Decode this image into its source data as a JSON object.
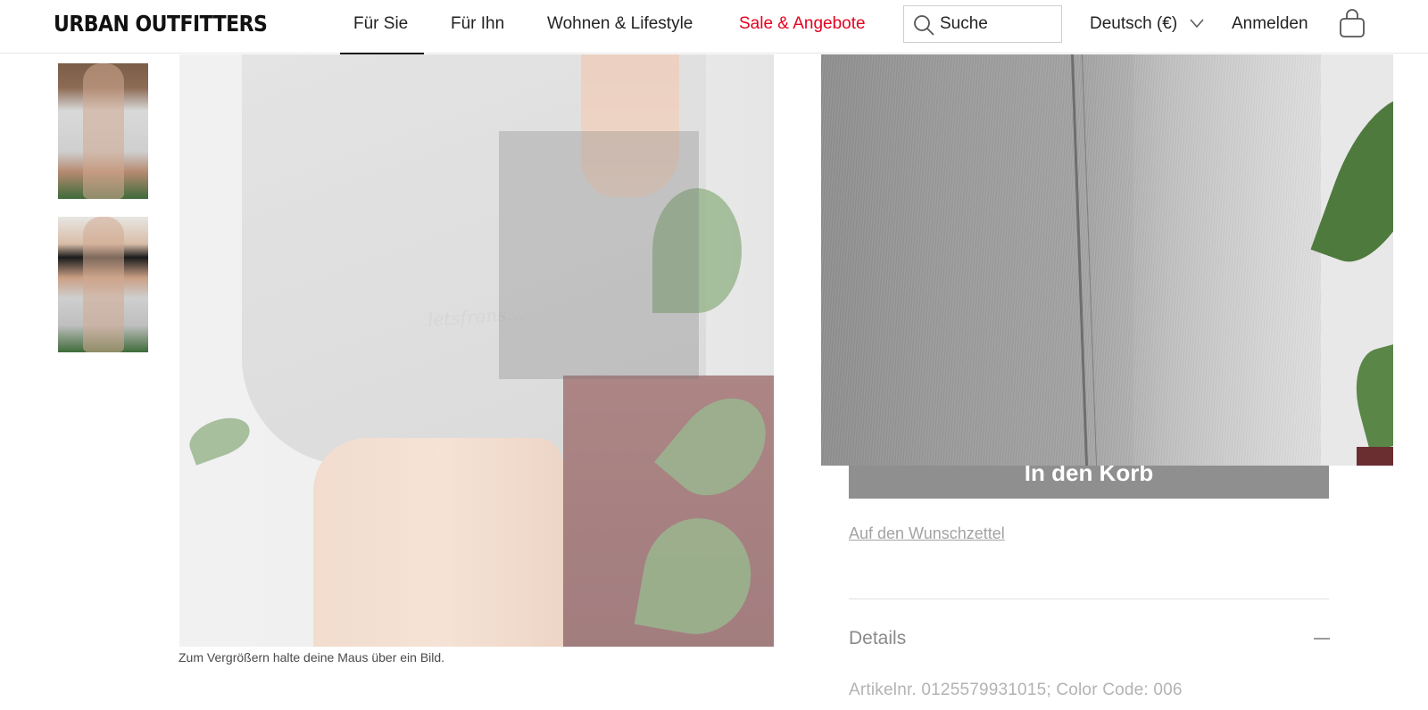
{
  "header": {
    "logo": "URBAN OUTFITTERS",
    "nav": [
      {
        "label": "Für Sie"
      },
      {
        "label": "Für Ihn"
      },
      {
        "label": "Wohnen & Lifestyle"
      },
      {
        "label": "Sale & Angebote",
        "color": "#e5001e"
      }
    ],
    "search": {
      "placeholder": "Suche",
      "icon": "search-icon"
    },
    "language": "Deutsch (€)",
    "login": "Anmelden",
    "bag_icon": "shopping-bag-icon"
  },
  "gallery": {
    "caption": "Zum Vergrößern halte deine Maus über ein Bild.",
    "thumbnails": 2
  },
  "product": {
    "add_to_cart": "In den Korb",
    "wishlist": "Auf den Wunschzettel",
    "details_title": "Details",
    "article_info": "Artikelnr. 0125579931015; Color Code: 006",
    "embroidery_text": "letsfrans..."
  }
}
